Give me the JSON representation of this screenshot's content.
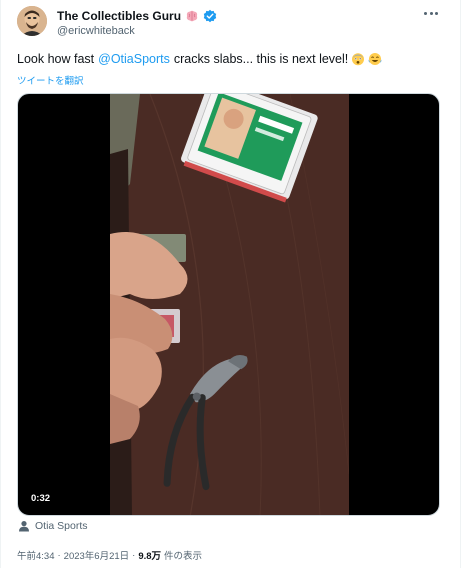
{
  "author": {
    "display_name": "The Collectibles Guru",
    "handle": "@ericwhiteback",
    "name_emoji": "brain-emoji",
    "verified": true,
    "verified_color": "#1d9bf0"
  },
  "tweet": {
    "text_before": "Look how fast",
    "mention": "@OtiaSports",
    "text_after": "cracks slabs... this is next level!",
    "emojis": [
      "astonished-face-emoji",
      "tears-of-joy-emoji"
    ],
    "translate_label": "ツイートを翻訳"
  },
  "media": {
    "type": "video",
    "duration": "0:32"
  },
  "attribution": {
    "icon": "person-icon",
    "label": "Otia Sports"
  },
  "meta": {
    "time": "午前4:34",
    "separator": "·",
    "date": "2023年6月21日",
    "separator2": "·",
    "views_count": "9.8万",
    "views_label": "件の表示"
  },
  "colors": {
    "link": "#1d9bf0",
    "secondary_text": "#536471",
    "primary_text": "#0f1419",
    "border": "#cfd9de"
  }
}
